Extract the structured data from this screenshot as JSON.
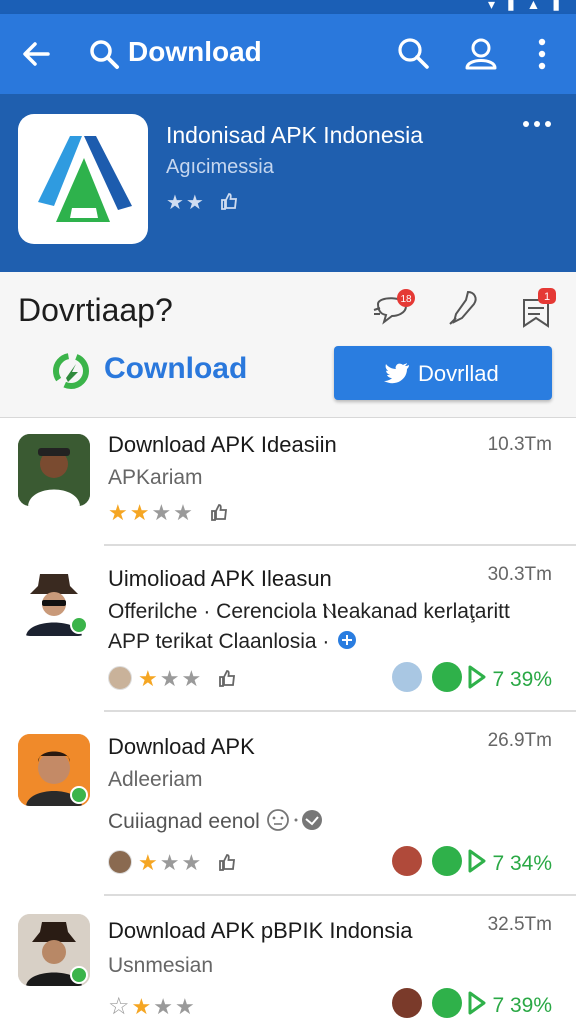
{
  "appbar": {
    "title": "Download"
  },
  "hero": {
    "app_title": "Indonisad APK Indonesia",
    "developer": "Agıcimessia",
    "rating_stars": "★★"
  },
  "actions": {
    "question": "Dovrtiaap?",
    "notif_badge_1": "18",
    "notif_badge_2": "1",
    "secondary_label": "Cownload",
    "primary_label": "Dovrllad"
  },
  "list": [
    {
      "title": "Download APK Ideasiin",
      "subtitle": "APKariam",
      "size": "10.3Tm",
      "rating": 2
    },
    {
      "title": "Uimolioad APK Ileasun",
      "desc1": "Offerilche · Cerenciola Ⲛeakanad kerlaţaritt",
      "desc2": "APP terikat Claanlosia ·",
      "size": "30.3Tm",
      "rating": 1,
      "percent": "7 39%"
    },
    {
      "title": "Download APK",
      "subtitle": "Adleeriam",
      "desc": "Cuiiagnad eenol",
      "size": "26.9Tm",
      "rating": 1,
      "percent": "7 34%"
    },
    {
      "title": "Download APK pBPIK Indonsia",
      "subtitle": "Usnmesian",
      "size": "32.5Tm",
      "rating": 1,
      "percent": "7 39%"
    }
  ],
  "colors": {
    "appbar": "#2a78dc",
    "hero": "#1f5faf",
    "accent_green": "#2aa845",
    "star": "#f5a623"
  }
}
